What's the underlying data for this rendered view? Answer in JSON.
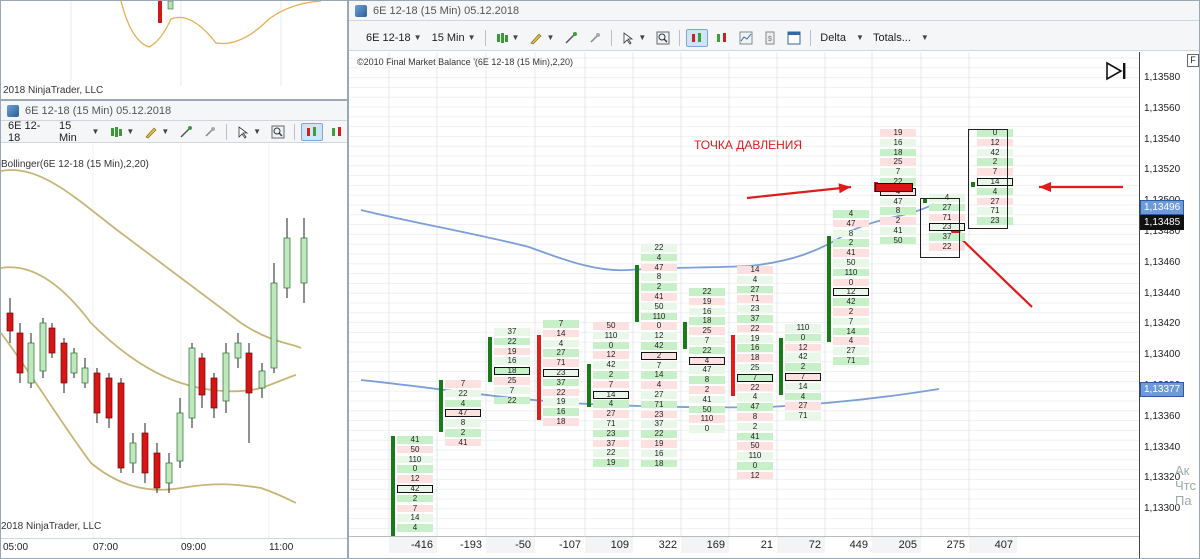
{
  "top_left": {
    "copyright": "2018 NinjaTrader, LLC"
  },
  "left": {
    "title": "6E 12-18 (15 Min)  05.12.2018",
    "toolbar": {
      "instrument": "6E 12-18",
      "period": "15 Min"
    },
    "indicator_label": "Bollinger(6E 12-18 (15 Min),2,20)",
    "copyright": "2018 NinjaTrader, LLC",
    "time_labels": [
      "05:00",
      "07:00",
      "09:00",
      "11:00"
    ]
  },
  "main": {
    "title": "6E 12-18 (15 Min)  05.12.2018",
    "toolbar": {
      "instrument": "6E 12-18",
      "period": "15 Min",
      "delta": "Delta",
      "totals": "Totals..."
    },
    "indicator_label": "©2010 Final Market Balance  '(6E 12-18 (15 Min),2,20)",
    "annotation": "ТОЧКА ДАВЛЕНИЯ",
    "price_labels": [
      "1,13580",
      "1,13560",
      "1,13540",
      "1,13520",
      "1,13500",
      "1,13480",
      "1,13460",
      "1,13440",
      "1,13420",
      "1,13400",
      "1,13380",
      "1,13360",
      "1,13340",
      "1,13320",
      "1,13300"
    ],
    "price_tag_1": "1,13496",
    "price_tag_2": "1,13485",
    "price_tag_3": "1,13377",
    "deltas": [
      "-416",
      "-193",
      "-50",
      "-107",
      "109",
      "322",
      "169",
      "21",
      "72",
      "449",
      "205",
      "275",
      "407"
    ],
    "f_button": "F",
    "right_edge_text": "Ак Чтс Па"
  },
  "colors": {
    "bull": "#1a7a1a",
    "bear": "#e21b1b",
    "ma": "#7b9fd6",
    "bb": "#c5b678",
    "arrow": "#e01b1b"
  }
}
